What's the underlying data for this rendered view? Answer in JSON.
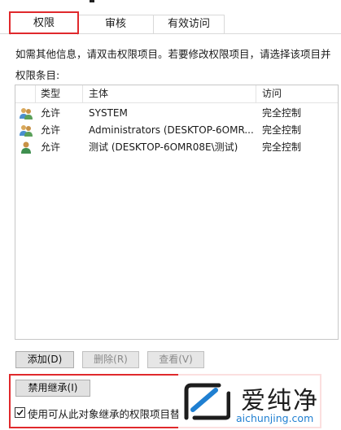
{
  "tabs": [
    {
      "label": "权限",
      "active": true
    },
    {
      "label": "审核",
      "active": false
    },
    {
      "label": "有效访问",
      "active": false
    }
  ],
  "info_text": "如需其他信息，请双击权限项目。若要修改权限项目，请选择该项目并",
  "entries_label": "权限条目:",
  "columns": [
    "类型",
    "主体",
    "访问"
  ],
  "entries": [
    {
      "icon": "group-users-icon",
      "type": "允许",
      "principal": "SYSTEM",
      "access": "完全控制"
    },
    {
      "icon": "group-users-icon",
      "type": "允许",
      "principal": "Administrators (DESKTOP-6OMR...",
      "access": "完全控制"
    },
    {
      "icon": "user-icon",
      "type": "允许",
      "principal": "测试 (DESKTOP-6OMR08E\\测试)",
      "access": "完全控制"
    }
  ],
  "buttons": {
    "add": "添加(D)",
    "remove": "删除(R)",
    "view": "查看(V)",
    "disable_inheritance": "禁用继承(I)"
  },
  "inherit_checkbox": {
    "label": "使用可从此对象继承的权限项目替",
    "checked": true
  },
  "watermark": {
    "name": "爱纯净",
    "url": "aichunjing.com"
  },
  "colors": {
    "highlight": "#e0292c",
    "watermark_url": "#1f7fd1"
  }
}
